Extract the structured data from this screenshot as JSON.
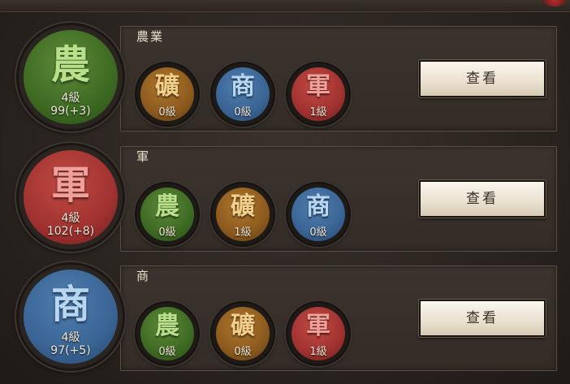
{
  "categories": [
    {
      "title": "農業",
      "main": {
        "char": "農",
        "color": "green",
        "level": "4級",
        "points": "99(+3)"
      },
      "others": [
        {
          "char": "礦",
          "color": "brown",
          "level": "0級"
        },
        {
          "char": "商",
          "color": "blue",
          "level": "0級"
        },
        {
          "char": "軍",
          "color": "red",
          "level": "1級"
        }
      ],
      "button": "查看"
    },
    {
      "title": "軍",
      "main": {
        "char": "軍",
        "color": "red",
        "level": "4級",
        "points": "102(+8)"
      },
      "others": [
        {
          "char": "農",
          "color": "green",
          "level": "0級"
        },
        {
          "char": "礦",
          "color": "brown",
          "level": "1級"
        },
        {
          "char": "商",
          "color": "blue",
          "level": "0級"
        }
      ],
      "button": "查看"
    },
    {
      "title": "商",
      "main": {
        "char": "商",
        "color": "blue",
        "level": "4級",
        "points": "97(+5)"
      },
      "others": [
        {
          "char": "農",
          "color": "green",
          "level": "0級"
        },
        {
          "char": "礦",
          "color": "brown",
          "level": "0級"
        },
        {
          "char": "軍",
          "color": "red",
          "level": "1級"
        }
      ],
      "button": "查看"
    }
  ]
}
